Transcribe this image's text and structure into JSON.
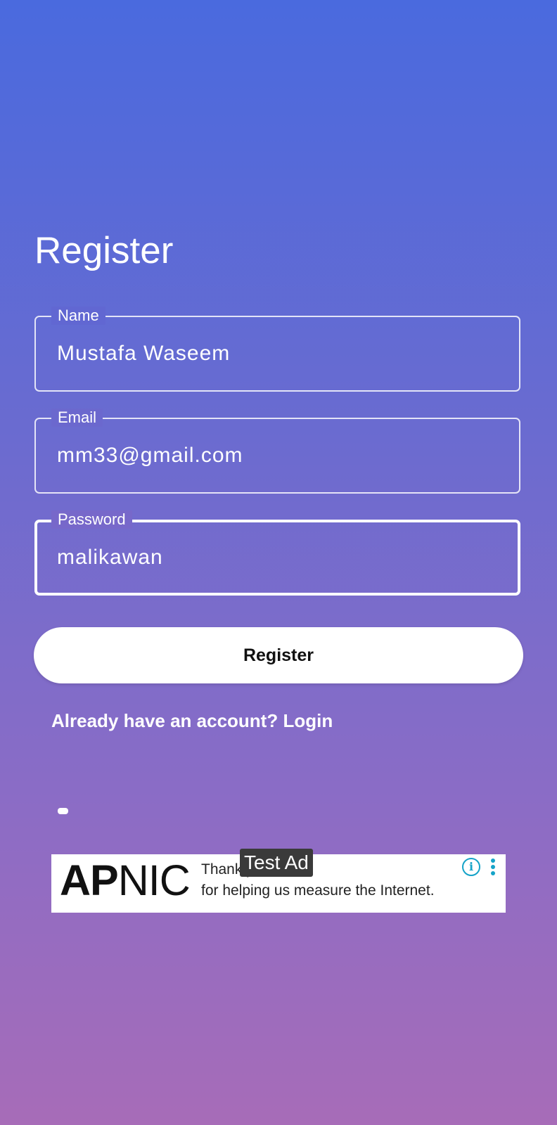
{
  "page": {
    "title": "Register"
  },
  "form": {
    "name": {
      "label": "Name",
      "value": "Mustafa Waseem"
    },
    "email": {
      "label": "Email",
      "value": "mm33@gmail.com"
    },
    "password": {
      "label": "Password",
      "value": "malikawan"
    },
    "register_label": "Register",
    "login_prompt": "Already have an account? Login"
  },
  "ad": {
    "logo_bold": "AP",
    "logo_light": "NIC",
    "text_top": "Thank you",
    "text_bottom": "for helping us measure the Internet.",
    "badge": "Test Ad",
    "info_icon": "info-icon",
    "more_icon": "more-vert-icon",
    "accent_color": "#15A3C8"
  },
  "colors": {
    "gradient_top": "#4A6ADE",
    "gradient_bottom": "#A76CB8",
    "button_background": "#FFFFFF",
    "button_text": "#111111"
  }
}
